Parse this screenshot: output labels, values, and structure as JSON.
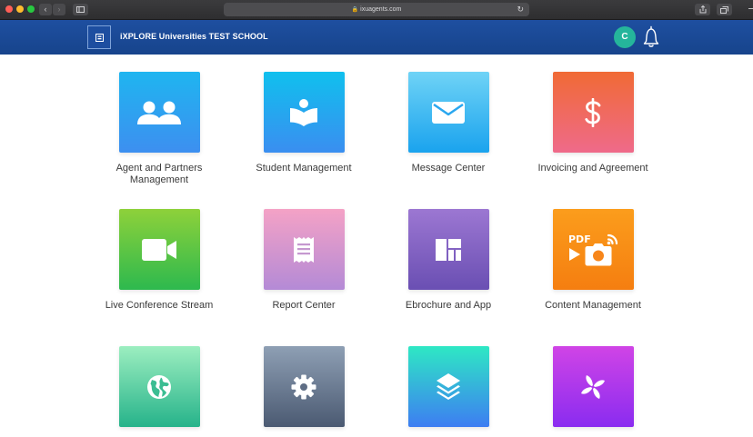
{
  "browser": {
    "url": "ixuagents.com",
    "nav_back": "‹",
    "nav_forward": "›"
  },
  "header": {
    "title": "iXPLORE Universities TEST SCHOOL",
    "avatar_initial": "C",
    "brand_color": "#1b4a99"
  },
  "tiles": [
    {
      "label": "Agent and Partners Management",
      "icon": "people-icon",
      "gradient": [
        "#1fb5f0",
        "#3d8ff0"
      ]
    },
    {
      "label": "Student Management",
      "icon": "reader-icon",
      "gradient": [
        "#10c0ee",
        "#3a8ef0"
      ]
    },
    {
      "label": "Message Center",
      "icon": "envelope-icon",
      "gradient": [
        "#6fd3f6",
        "#1aa3ee"
      ]
    },
    {
      "label": "Invoicing and Agreement",
      "icon": "dollar-icon",
      "gradient": [
        "#f06a35",
        "#ef6a8a"
      ]
    },
    {
      "label": "Live Conference Stream",
      "icon": "video-camera-icon",
      "gradient": [
        "#8ed13a",
        "#2db94e"
      ]
    },
    {
      "label": "Report Center",
      "icon": "receipt-icon",
      "gradient": [
        "#f4a2c6",
        "#b48ad6"
      ]
    },
    {
      "label": "Ebrochure and App",
      "icon": "dashboard-icon",
      "gradient": [
        "#9c77d2",
        "#6a4fb3"
      ]
    },
    {
      "label": "Content Management",
      "icon": "pdf-media-icon",
      "gradient": [
        "#fb9d1c",
        "#f57e10"
      ]
    },
    {
      "label": "",
      "icon": "globe-icon",
      "gradient": [
        "#9ceec0",
        "#26b38a"
      ]
    },
    {
      "label": "",
      "icon": "gear-icon",
      "gradient": [
        "#8e9fb4",
        "#4b5a72"
      ]
    },
    {
      "label": "",
      "icon": "layers-icon",
      "gradient": [
        "#2ee8c4",
        "#3d7df2"
      ]
    },
    {
      "label": "",
      "icon": "pinwheel-icon",
      "gradient": [
        "#d044e6",
        "#8a2cf0"
      ]
    }
  ]
}
